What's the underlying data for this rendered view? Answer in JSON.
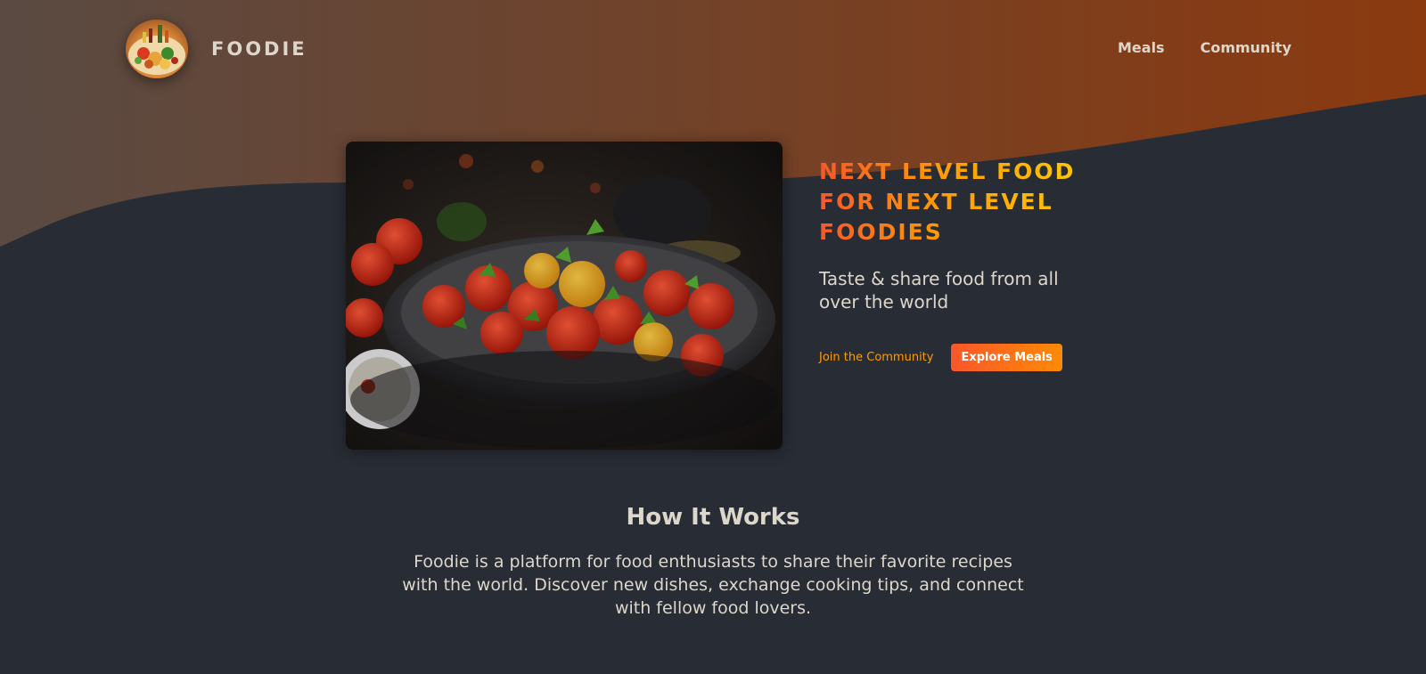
{
  "colors": {
    "background": "#282c34",
    "header_gradient_start": "#5a4a42",
    "header_gradient_end": "#8b3a0f",
    "accent_orange": "#f9572a",
    "accent_yellow": "#ffc905",
    "text": "#ddd6cb"
  },
  "header": {
    "logo_icon": "food-platter-logo",
    "brand_name": "FOODIE",
    "nav": [
      {
        "label": "Meals"
      },
      {
        "label": "Community"
      }
    ]
  },
  "hero": {
    "image_icon": "tomato-salad-photo",
    "title": "NEXT LEVEL FOOD FOR NEXT LEVEL FOODIES",
    "subtitle": "Taste & share food from all over the world",
    "join_link": "Join the Community",
    "explore_button": "Explore Meals"
  },
  "how_it_works": {
    "heading": "How It Works",
    "description": "Foodie is a platform for food enthusiasts to share their favorite recipes with the world. Discover new dishes, exchange cooking tips, and connect with fellow food lovers."
  }
}
